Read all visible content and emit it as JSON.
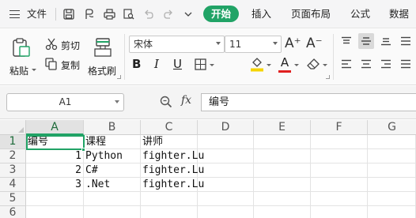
{
  "menubar": {
    "file_label": "文件",
    "tabs": [
      {
        "label": "开始",
        "active": true
      },
      {
        "label": "插入"
      },
      {
        "label": "页面布局"
      },
      {
        "label": "公式"
      },
      {
        "label": "数据"
      }
    ],
    "accent_color": "#21a366"
  },
  "ribbon": {
    "paste_label": "粘贴",
    "cut_label": "剪切",
    "copy_label": "复制",
    "format_painter_label": "格式刷",
    "font_name": "宋体",
    "font_size": "11",
    "grow_font_glyph": "A⁺",
    "shrink_font_glyph": "A⁻",
    "bold": "B",
    "italic": "I",
    "underline": "U",
    "font_color_glyph": "A",
    "font_color": "#e02020",
    "fill_color": "#f5d400"
  },
  "formula_bar": {
    "name_box": "A1",
    "fx_label": "fx",
    "content": "编号"
  },
  "sheet": {
    "columns": [
      "A",
      "B",
      "C",
      "D",
      "E",
      "F",
      "G"
    ],
    "rows": [
      "1",
      "2",
      "3",
      "4",
      "5",
      "6"
    ],
    "selected_column": "A",
    "selected_row": "1",
    "cells": {
      "A1": "编号",
      "B1": "课程",
      "C1": "讲师",
      "A2": "1",
      "B2": "Python",
      "C2": "fighter.Lu",
      "A3": "2",
      "B3": "C#",
      "C3": "fighter.Lu",
      "A4": "3",
      "B4": ".Net",
      "C4": "fighter.Lu"
    }
  }
}
